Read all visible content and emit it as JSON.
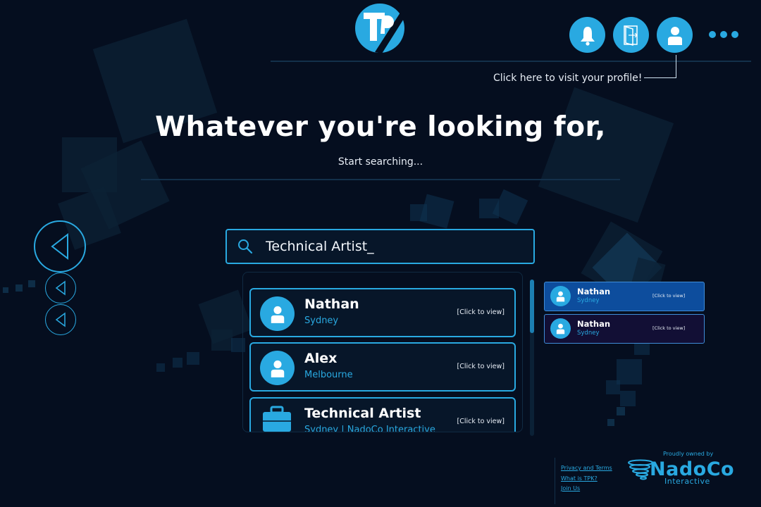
{
  "header": {
    "logo_icon": "tpk-logo-icon",
    "actions": [
      {
        "name": "notifications-button",
        "icon": "bell-icon"
      },
      {
        "name": "logout-button",
        "icon": "door-icon"
      },
      {
        "name": "profile-button",
        "icon": "user-icon"
      }
    ],
    "more_icon": "more-dots-icon",
    "profile_hint": "Click here to visit your profile!"
  },
  "hero": {
    "title": "Whatever you're looking for,",
    "subtitle": "Start searching..."
  },
  "search": {
    "value": "Technical Artist_"
  },
  "results": [
    {
      "title": "Nathan",
      "subtitle": "Sydney",
      "cta": "[Click to view]",
      "icon": "user-icon"
    },
    {
      "title": "Alex",
      "subtitle": "Melbourne",
      "cta": "[Click to view]",
      "icon": "user-icon"
    },
    {
      "title": "Technical Artist",
      "subtitle": "Sydney  | NadoCo Interactive",
      "cta": "[Click to view]",
      "icon": "briefcase-icon"
    }
  ],
  "recent": [
    {
      "title": "Nathan",
      "subtitle": "Sydney",
      "cta": "[Click to view]",
      "state": "selected"
    },
    {
      "title": "Nathan",
      "subtitle": "Sydney",
      "cta": "[Click to view]",
      "state": "default"
    }
  ],
  "footer": {
    "links": [
      "Privacy and Terms",
      "What is TPK?",
      "Join Us"
    ],
    "owned_by": "Proudly owned by",
    "brand_name": "NadoCo",
    "brand_sub": "Interactive"
  },
  "colors": {
    "background": "#050e1f",
    "accent": "#29a9e1",
    "selected_card": "#0d4d9d",
    "default_card": "#120f35"
  }
}
